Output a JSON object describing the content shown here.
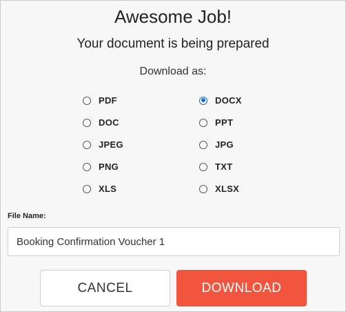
{
  "dialog": {
    "title": "Awesome Job!",
    "subtitle": "Your document is being prepared",
    "download_as_label": "Download as:"
  },
  "formats": [
    {
      "label": "PDF",
      "selected": false
    },
    {
      "label": "DOCX",
      "selected": true
    },
    {
      "label": "DOC",
      "selected": false
    },
    {
      "label": "PPT",
      "selected": false
    },
    {
      "label": "JPEG",
      "selected": false
    },
    {
      "label": "JPG",
      "selected": false
    },
    {
      "label": "PNG",
      "selected": false
    },
    {
      "label": "TXT",
      "selected": false
    },
    {
      "label": "XLS",
      "selected": false
    },
    {
      "label": "XLSX",
      "selected": false
    }
  ],
  "file": {
    "label": "File Name:",
    "value": "Booking Confirmation Voucher 1"
  },
  "buttons": {
    "cancel": "CANCEL",
    "download": "DOWNLOAD"
  },
  "colors": {
    "accent": "#f1553d",
    "radio_selected": "#1a6fd6"
  }
}
